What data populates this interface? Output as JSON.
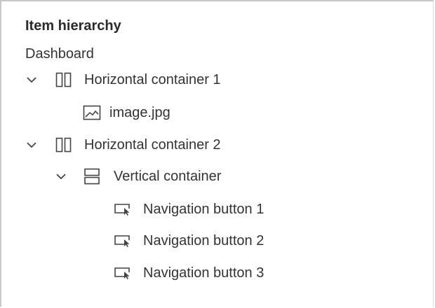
{
  "panel": {
    "title": "Item hierarchy",
    "root": "Dashboard",
    "items": [
      {
        "label": "Horizontal container 1",
        "icon": "horizontal-container-icon",
        "expanded": true
      },
      {
        "label": "image.jpg",
        "icon": "image-icon"
      },
      {
        "label": "Horizontal container 2",
        "icon": "horizontal-container-icon",
        "expanded": true
      },
      {
        "label": "Vertical container",
        "icon": "vertical-container-icon",
        "expanded": true
      },
      {
        "label": "Navigation button 1",
        "icon": "navigation-button-icon"
      },
      {
        "label": "Navigation button 2",
        "icon": "navigation-button-icon"
      },
      {
        "label": "Navigation button 3",
        "icon": "navigation-button-icon"
      }
    ]
  }
}
